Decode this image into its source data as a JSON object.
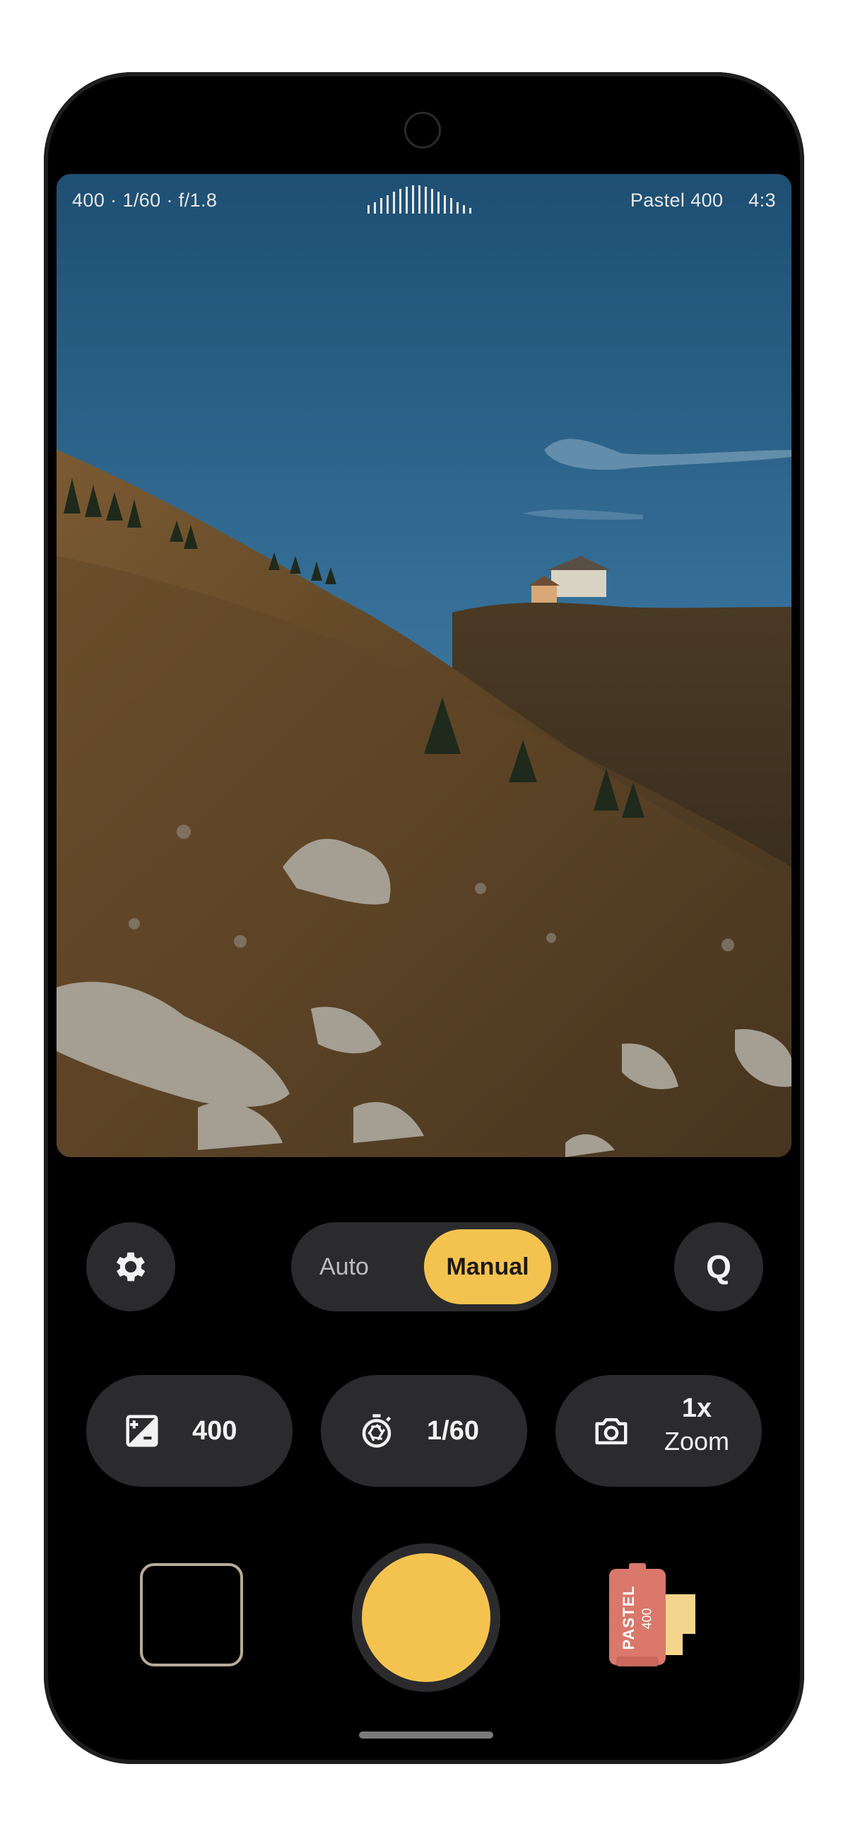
{
  "status": {
    "exposure_readout": "400 · 1/60 · f/1.8",
    "film_name": "Pastel 400",
    "aspect_ratio": "4:3"
  },
  "mode_toggle": {
    "auto_label": "Auto",
    "manual_label": "Manual",
    "selected": "Manual"
  },
  "quick_button": {
    "label": "Q"
  },
  "controls": {
    "iso": {
      "value": "400",
      "icon": "exposure-icon"
    },
    "shutter": {
      "value": "1/60",
      "icon": "timer-icon"
    },
    "zoom": {
      "value": "1x",
      "label": "Zoom",
      "icon": "camera-icon"
    }
  },
  "film_roll": {
    "brand": "PASTEL",
    "speed": "400"
  },
  "colors": {
    "accent": "#f4c34f",
    "button_bg": "#2b2b2d",
    "film_red": "#d9786b",
    "film_cream": "#f3d58e"
  }
}
